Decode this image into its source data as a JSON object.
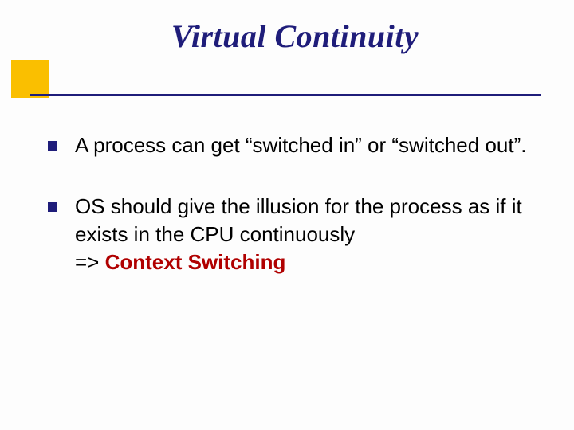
{
  "slide": {
    "title": "Virtual  Continuity",
    "bullets": [
      {
        "text": "A process can get “switched in” or “switched out”."
      },
      {
        "text_prefix": "OS should give the illusion for the process as if it exists in the CPU continuously",
        "text_arrow": "=> ",
        "text_emphasis": "Context Switching"
      }
    ]
  }
}
